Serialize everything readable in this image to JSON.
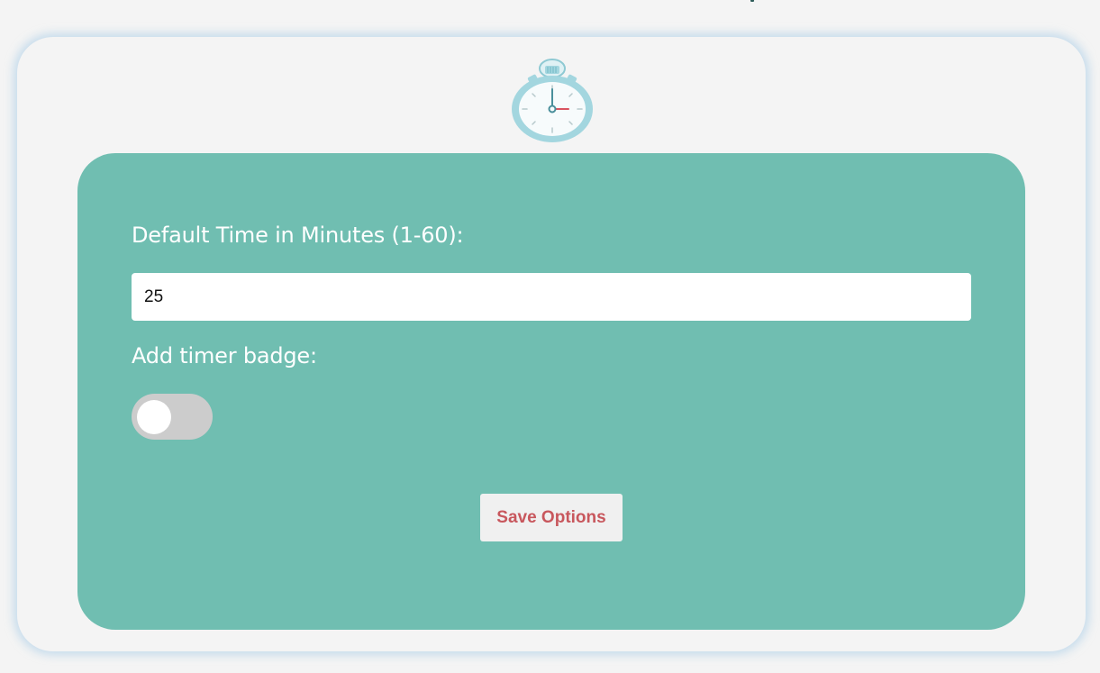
{
  "colors": {
    "page_background": "#f4f4f4",
    "panel": "#70beb1",
    "card_glow": "#a0c8e6",
    "save_text": "#c8575d",
    "toggle_off_track": "#cccccc",
    "stopwatch_ring": "#a3d6df"
  },
  "header": {
    "icon": "stopwatch-icon"
  },
  "options": {
    "default_time_label": "Default Time in Minutes (1-60):",
    "default_time_value": "25",
    "badge_label": "Add timer badge:",
    "badge_enabled": false,
    "save_label": "Save Options"
  }
}
